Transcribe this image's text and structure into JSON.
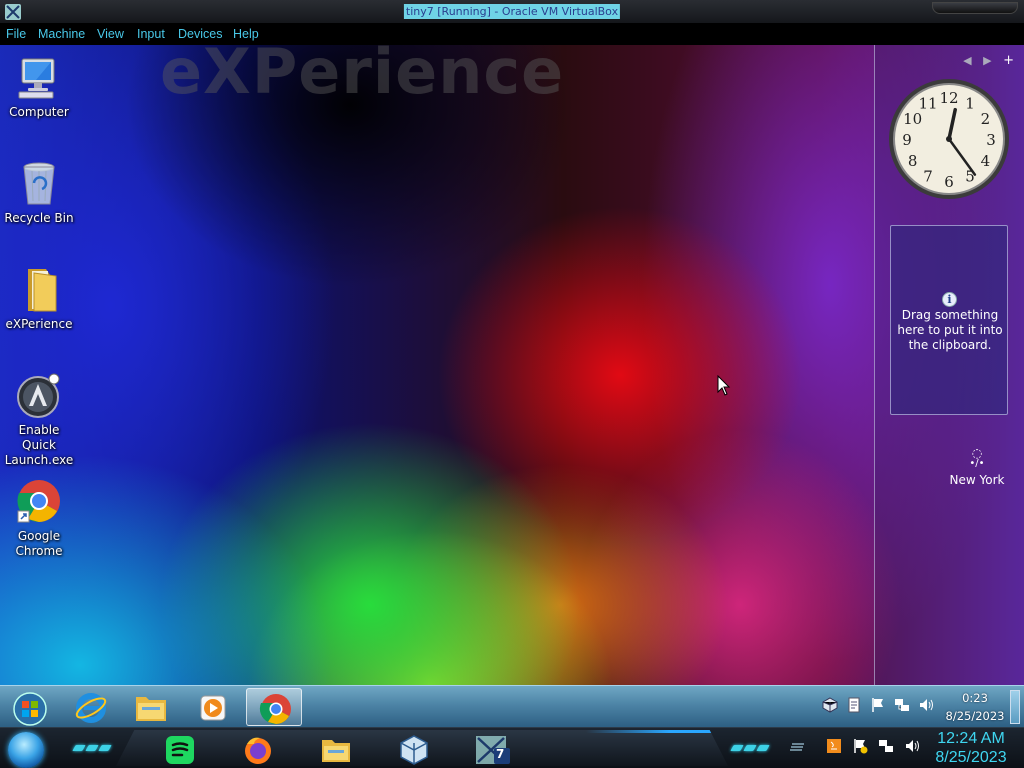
{
  "host_window": {
    "title": "tiny7 [Running] - Oracle VM VirtualBox",
    "menu": [
      "File",
      "Machine",
      "View",
      "Input",
      "Devices",
      "Help"
    ]
  },
  "desktop": {
    "watermark": "eXPerience",
    "icons": [
      {
        "label": "Computer",
        "icon": "computer-icon"
      },
      {
        "label": "Recycle Bin",
        "icon": "recycle-bin-icon"
      },
      {
        "label": "eXPerience",
        "icon": "folder-icon"
      },
      {
        "label": "Enable Quick Launch.exe",
        "icon": "quick-launch-icon"
      },
      {
        "label": "Google Chrome",
        "icon": "chrome-icon"
      }
    ]
  },
  "sidebar": {
    "nav": {
      "prev": "◀",
      "next": "▶",
      "add": "+"
    },
    "clock": {
      "hour": 12,
      "minute": 24,
      "numerals": [
        "12",
        "1",
        "2",
        "3",
        "4",
        "5",
        "6",
        "7",
        "8",
        "9",
        "10",
        "11"
      ]
    },
    "clipboard": {
      "info_glyph": "i",
      "text": "Drag something here to put it into the clipboard."
    },
    "weather": {
      "loading": "◌",
      "city": "New York"
    }
  },
  "guest_taskbar": {
    "buttons": [
      {
        "name": "start-orb",
        "icon": "windows-orb-icon"
      },
      {
        "name": "internet-explorer",
        "icon": "ie-icon"
      },
      {
        "name": "file-explorer",
        "icon": "folder-icon"
      },
      {
        "name": "media-player",
        "icon": "media-player-icon"
      },
      {
        "name": "google-chrome",
        "icon": "chrome-icon",
        "active": true
      }
    ],
    "tray_icons": [
      "virtualbox-tray-icon",
      "notes-icon",
      "flag-icon",
      "network-icon",
      "volume-icon"
    ],
    "time": "0:23",
    "date": "8/25/2023"
  },
  "host_taskbar": {
    "dock_apps": [
      "spotify-icon",
      "firefox-icon",
      "file-explorer-icon",
      "virtualbox-icon",
      "tiny7-vm-icon"
    ],
    "vm_badge": "7",
    "tray_icons": [
      "bars-icon",
      "java-icon",
      "warning-flag-icon",
      "network-icon",
      "volume-icon"
    ],
    "time": "12:24 AM",
    "date": "8/25/2023"
  },
  "colors": {
    "accent": "#3fd6f0",
    "menu_text": "#49c8e8",
    "title_highlight": "#6fd3e6"
  }
}
